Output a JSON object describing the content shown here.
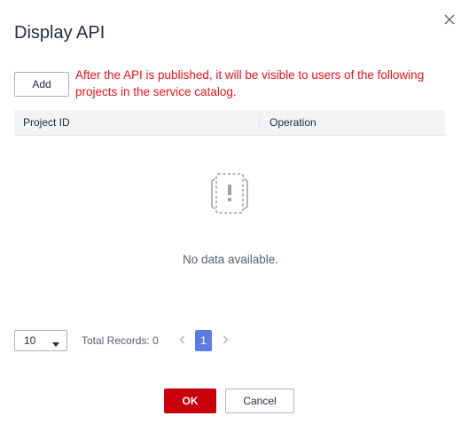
{
  "dialog": {
    "title": "Display API",
    "close_icon": "close-icon"
  },
  "toolbar": {
    "add_label": "Add",
    "notice": "After the API is published, it will be visible to users of the following projects in the service catalog.",
    "notice_color": "#e6131c"
  },
  "table": {
    "columns": [
      "Project ID",
      "Operation"
    ],
    "rows": [],
    "empty_icon": "empty-data-icon",
    "empty_text": "No data available."
  },
  "pagination": {
    "page_size": "10",
    "total_records": "Total Records: 0",
    "current_page": "1",
    "accent": "#5e7ce0"
  },
  "footer": {
    "ok_label": "OK",
    "cancel_label": "Cancel",
    "ok_color": "#c7000b"
  }
}
